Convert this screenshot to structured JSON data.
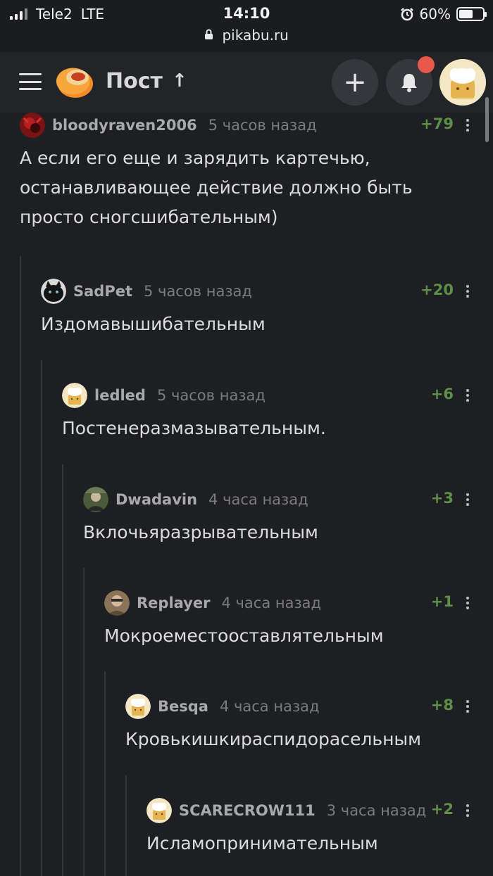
{
  "status_bar": {
    "carrier": "Tele2",
    "network": "LTE",
    "time": "14:10",
    "battery": "60%",
    "battery_level": 0.6,
    "url": "pikabu.ru"
  },
  "header": {
    "title": "Пост",
    "up_arrow": "↑",
    "add_symbol": "+"
  },
  "comments": [
    {
      "author": "bloodyraven2006",
      "time": "5 часов назад",
      "rating": "+79",
      "text": "А если его еще и зарядить картечью, останавливающее действие должно быть просто сногсшибательным)"
    },
    {
      "author": "SadPet",
      "time": "5 часов назад",
      "rating": "+20",
      "text": "Издомавышибательным"
    },
    {
      "author": "ledled",
      "time": "5 часов назад",
      "rating": "+6",
      "text": "Постенеразмазывательным."
    },
    {
      "author": "Dwadavin",
      "time": "4 часа назад",
      "rating": "+3",
      "text": "Вклочьяразрывательным"
    },
    {
      "author": "Replayer",
      "time": "4 часа назад",
      "rating": "+1",
      "text": "Мокроеместооставлятельным"
    },
    {
      "author": "Besqa",
      "time": "4 часа назад",
      "rating": "+8",
      "text": "Кровькишкираспидорасельным"
    },
    {
      "author": "SCARECROW111",
      "time": "3 часа назад",
      "rating": "+2",
      "text": "Исламопринимательным"
    }
  ],
  "colors": {
    "background": "#1e1f23",
    "rating_positive": "#5d8f49",
    "notification": "#e8594c"
  }
}
